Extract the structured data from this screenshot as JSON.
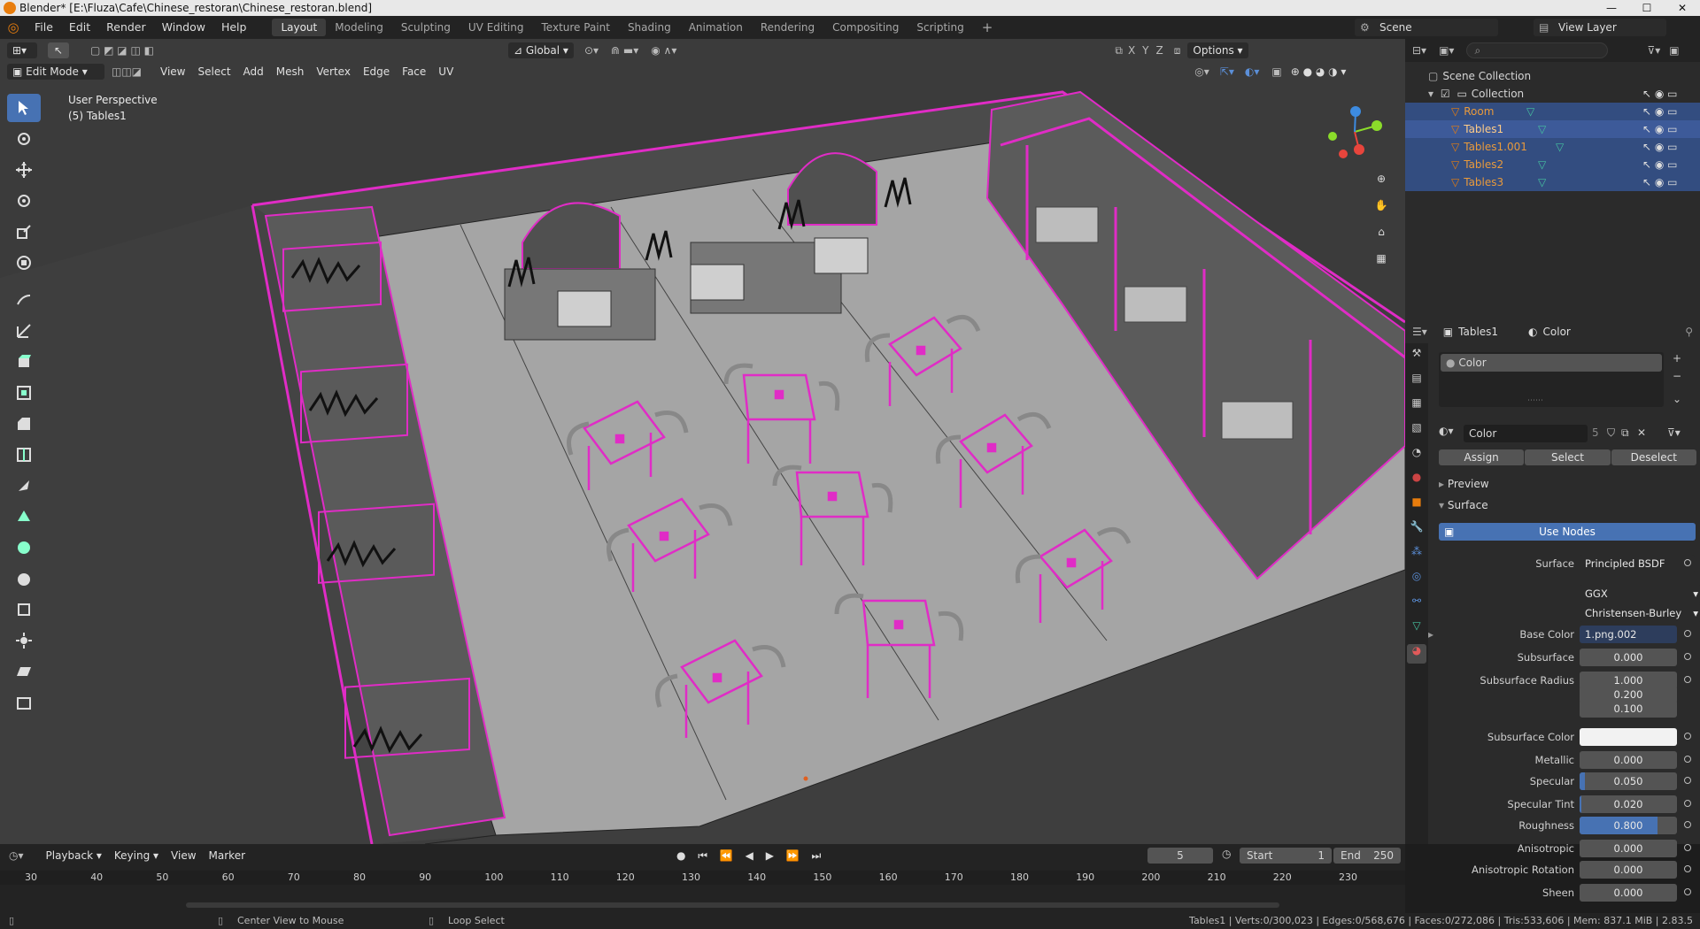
{
  "window": {
    "title": "Blender* [E:\\Fluza\\Cafe\\Chinese_restoran\\Chinese_restoran.blend]"
  },
  "menu": [
    "File",
    "Edit",
    "Render",
    "Window",
    "Help"
  ],
  "workspaces": [
    "Layout",
    "Modeling",
    "Sculpting",
    "UV Editing",
    "Texture Paint",
    "Shading",
    "Animation",
    "Rendering",
    "Compositing",
    "Scripting"
  ],
  "active_workspace": "Layout",
  "scene": {
    "name": "Scene",
    "view_layer": "View Layer"
  },
  "viewport": {
    "orientation": "Global",
    "options_label": "Options",
    "mode": "Edit Mode",
    "menus": [
      "View",
      "Select",
      "Add",
      "Mesh",
      "Vertex",
      "Edge",
      "Face",
      "UV"
    ],
    "overlay_title": "User Perspective",
    "overlay_object": "(5) Tables1",
    "axis_labels": [
      "X",
      "Y",
      "Z"
    ]
  },
  "outliner": {
    "root": "Scene Collection",
    "collection": "Collection",
    "objects": [
      "Room",
      "Tables1",
      "Tables1.001",
      "Tables2",
      "Tables3"
    ]
  },
  "properties": {
    "object": "Tables1",
    "material_tab": "Color",
    "slot": "Color",
    "material_name": "Color",
    "users": "5",
    "assign": "Assign",
    "select": "Select",
    "deselect": "Deselect",
    "preview": "Preview",
    "surface_section": "Surface",
    "use_nodes": "Use Nodes",
    "surface_label": "Surface",
    "surface_value": "Principled BSDF",
    "distribution": "GGX",
    "subsurface_method": "Christensen-Burley",
    "base_color_label": "Base Color",
    "base_color_value": "1.png.002",
    "rows": [
      {
        "label": "Subsurface",
        "value": "0.000",
        "fill": 0
      },
      {
        "label": "Subsurface Radius",
        "value": "1.000",
        "fill": 0
      },
      {
        "label": "",
        "value": "0.200",
        "fill": 0
      },
      {
        "label": "",
        "value": "0.100",
        "fill": 0
      },
      {
        "label": "Subsurface Color",
        "value": "",
        "fill": 0
      },
      {
        "label": "Metallic",
        "value": "0.000",
        "fill": 0
      },
      {
        "label": "Specular",
        "value": "0.050",
        "fill": 0.05
      },
      {
        "label": "Specular Tint",
        "value": "0.020",
        "fill": 0.02
      },
      {
        "label": "Roughness",
        "value": "0.800",
        "fill": 0.8
      },
      {
        "label": "Anisotropic",
        "value": "0.000",
        "fill": 0
      },
      {
        "label": "Anisotropic Rotation",
        "value": "0.000",
        "fill": 0
      },
      {
        "label": "Sheen",
        "value": "0.000",
        "fill": 0
      }
    ]
  },
  "timeline": {
    "menus": [
      "Playback",
      "Keying",
      "View",
      "Marker"
    ],
    "current_frame": "5",
    "start_label": "Start",
    "start": "1",
    "end_label": "End",
    "end": "250",
    "ruler": [
      "30",
      "40",
      "50",
      "60",
      "70",
      "80",
      "90",
      "100",
      "110",
      "120",
      "130",
      "140",
      "150",
      "160",
      "170",
      "180",
      "190",
      "200",
      "210",
      "220",
      "230"
    ]
  },
  "status": {
    "hint1": "Center View to Mouse",
    "hint2": "Loop Select",
    "stats": "Tables1 | Verts:0/300,023 | Edges:0/568,676 | Faces:0/272,086 | Tris:533,606 | Mem: 837.1 MiB | 2.83.5"
  },
  "colors": {
    "accent": "#4772b3",
    "selection": "#e02cc6",
    "brand": "#e87d0d"
  }
}
